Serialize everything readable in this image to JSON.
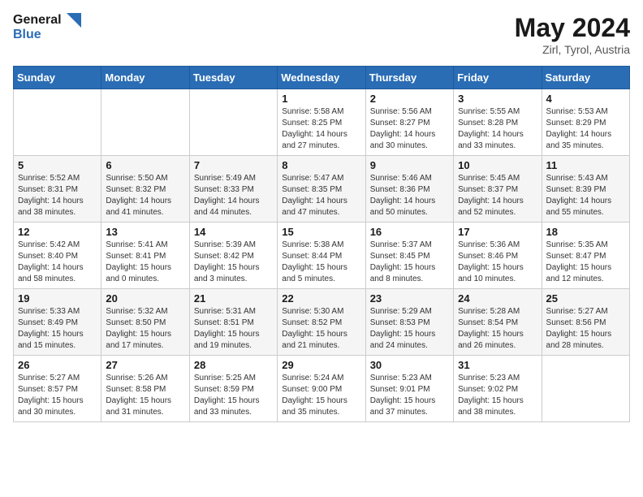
{
  "header": {
    "logo_line1": "General",
    "logo_line2": "Blue",
    "month_year": "May 2024",
    "location": "Zirl, Tyrol, Austria"
  },
  "weekdays": [
    "Sunday",
    "Monday",
    "Tuesday",
    "Wednesday",
    "Thursday",
    "Friday",
    "Saturday"
  ],
  "weeks": [
    [
      {
        "day": "",
        "info": ""
      },
      {
        "day": "",
        "info": ""
      },
      {
        "day": "",
        "info": ""
      },
      {
        "day": "1",
        "info": "Sunrise: 5:58 AM\nSunset: 8:25 PM\nDaylight: 14 hours\nand 27 minutes."
      },
      {
        "day": "2",
        "info": "Sunrise: 5:56 AM\nSunset: 8:27 PM\nDaylight: 14 hours\nand 30 minutes."
      },
      {
        "day": "3",
        "info": "Sunrise: 5:55 AM\nSunset: 8:28 PM\nDaylight: 14 hours\nand 33 minutes."
      },
      {
        "day": "4",
        "info": "Sunrise: 5:53 AM\nSunset: 8:29 PM\nDaylight: 14 hours\nand 35 minutes."
      }
    ],
    [
      {
        "day": "5",
        "info": "Sunrise: 5:52 AM\nSunset: 8:31 PM\nDaylight: 14 hours\nand 38 minutes."
      },
      {
        "day": "6",
        "info": "Sunrise: 5:50 AM\nSunset: 8:32 PM\nDaylight: 14 hours\nand 41 minutes."
      },
      {
        "day": "7",
        "info": "Sunrise: 5:49 AM\nSunset: 8:33 PM\nDaylight: 14 hours\nand 44 minutes."
      },
      {
        "day": "8",
        "info": "Sunrise: 5:47 AM\nSunset: 8:35 PM\nDaylight: 14 hours\nand 47 minutes."
      },
      {
        "day": "9",
        "info": "Sunrise: 5:46 AM\nSunset: 8:36 PM\nDaylight: 14 hours\nand 50 minutes."
      },
      {
        "day": "10",
        "info": "Sunrise: 5:45 AM\nSunset: 8:37 PM\nDaylight: 14 hours\nand 52 minutes."
      },
      {
        "day": "11",
        "info": "Sunrise: 5:43 AM\nSunset: 8:39 PM\nDaylight: 14 hours\nand 55 minutes."
      }
    ],
    [
      {
        "day": "12",
        "info": "Sunrise: 5:42 AM\nSunset: 8:40 PM\nDaylight: 14 hours\nand 58 minutes."
      },
      {
        "day": "13",
        "info": "Sunrise: 5:41 AM\nSunset: 8:41 PM\nDaylight: 15 hours\nand 0 minutes."
      },
      {
        "day": "14",
        "info": "Sunrise: 5:39 AM\nSunset: 8:42 PM\nDaylight: 15 hours\nand 3 minutes."
      },
      {
        "day": "15",
        "info": "Sunrise: 5:38 AM\nSunset: 8:44 PM\nDaylight: 15 hours\nand 5 minutes."
      },
      {
        "day": "16",
        "info": "Sunrise: 5:37 AM\nSunset: 8:45 PM\nDaylight: 15 hours\nand 8 minutes."
      },
      {
        "day": "17",
        "info": "Sunrise: 5:36 AM\nSunset: 8:46 PM\nDaylight: 15 hours\nand 10 minutes."
      },
      {
        "day": "18",
        "info": "Sunrise: 5:35 AM\nSunset: 8:47 PM\nDaylight: 15 hours\nand 12 minutes."
      }
    ],
    [
      {
        "day": "19",
        "info": "Sunrise: 5:33 AM\nSunset: 8:49 PM\nDaylight: 15 hours\nand 15 minutes."
      },
      {
        "day": "20",
        "info": "Sunrise: 5:32 AM\nSunset: 8:50 PM\nDaylight: 15 hours\nand 17 minutes."
      },
      {
        "day": "21",
        "info": "Sunrise: 5:31 AM\nSunset: 8:51 PM\nDaylight: 15 hours\nand 19 minutes."
      },
      {
        "day": "22",
        "info": "Sunrise: 5:30 AM\nSunset: 8:52 PM\nDaylight: 15 hours\nand 21 minutes."
      },
      {
        "day": "23",
        "info": "Sunrise: 5:29 AM\nSunset: 8:53 PM\nDaylight: 15 hours\nand 24 minutes."
      },
      {
        "day": "24",
        "info": "Sunrise: 5:28 AM\nSunset: 8:54 PM\nDaylight: 15 hours\nand 26 minutes."
      },
      {
        "day": "25",
        "info": "Sunrise: 5:27 AM\nSunset: 8:56 PM\nDaylight: 15 hours\nand 28 minutes."
      }
    ],
    [
      {
        "day": "26",
        "info": "Sunrise: 5:27 AM\nSunset: 8:57 PM\nDaylight: 15 hours\nand 30 minutes."
      },
      {
        "day": "27",
        "info": "Sunrise: 5:26 AM\nSunset: 8:58 PM\nDaylight: 15 hours\nand 31 minutes."
      },
      {
        "day": "28",
        "info": "Sunrise: 5:25 AM\nSunset: 8:59 PM\nDaylight: 15 hours\nand 33 minutes."
      },
      {
        "day": "29",
        "info": "Sunrise: 5:24 AM\nSunset: 9:00 PM\nDaylight: 15 hours\nand 35 minutes."
      },
      {
        "day": "30",
        "info": "Sunrise: 5:23 AM\nSunset: 9:01 PM\nDaylight: 15 hours\nand 37 minutes."
      },
      {
        "day": "31",
        "info": "Sunrise: 5:23 AM\nSunset: 9:02 PM\nDaylight: 15 hours\nand 38 minutes."
      },
      {
        "day": "",
        "info": ""
      }
    ]
  ]
}
